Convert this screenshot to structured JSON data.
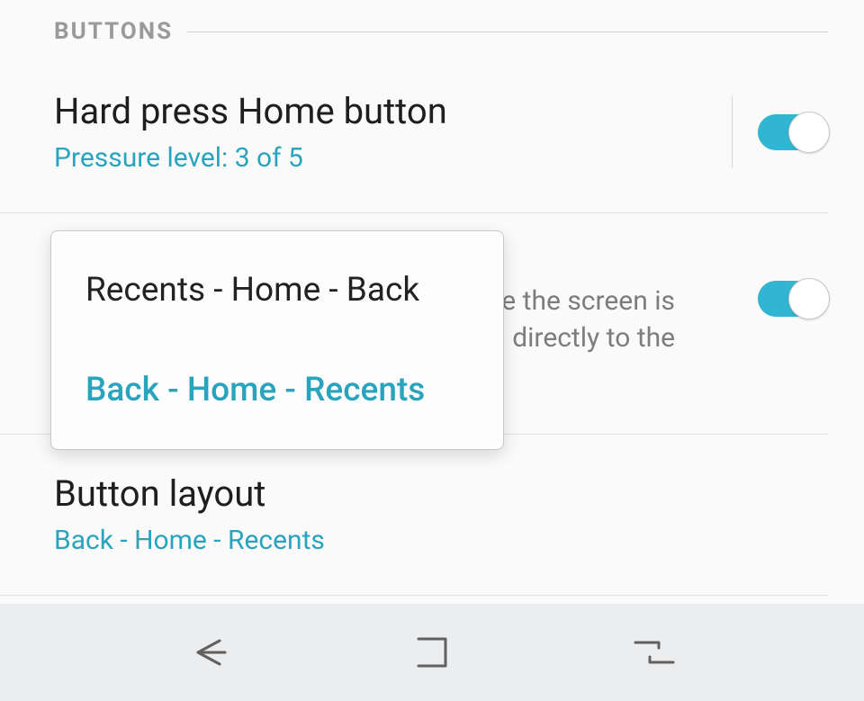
{
  "section": {
    "title": "BUTTONS"
  },
  "items": {
    "hard_press": {
      "title": "Hard press Home button",
      "subtitle": "Pressure level: 3 of 5",
      "toggle": true
    },
    "unlock": {
      "desc_visible_fragment_1": "e the screen is",
      "desc_visible_fragment_2": "directly to the",
      "toggle": true
    },
    "layout": {
      "title": "Button layout",
      "subtitle": "Back - Home - Recents"
    }
  },
  "popup": {
    "options": [
      {
        "label": "Recents - Home - Back",
        "selected": false
      },
      {
        "label": "Back - Home - Recents",
        "selected": true
      }
    ]
  },
  "nav": {
    "back": "back",
    "home": "home",
    "recents": "recents"
  }
}
